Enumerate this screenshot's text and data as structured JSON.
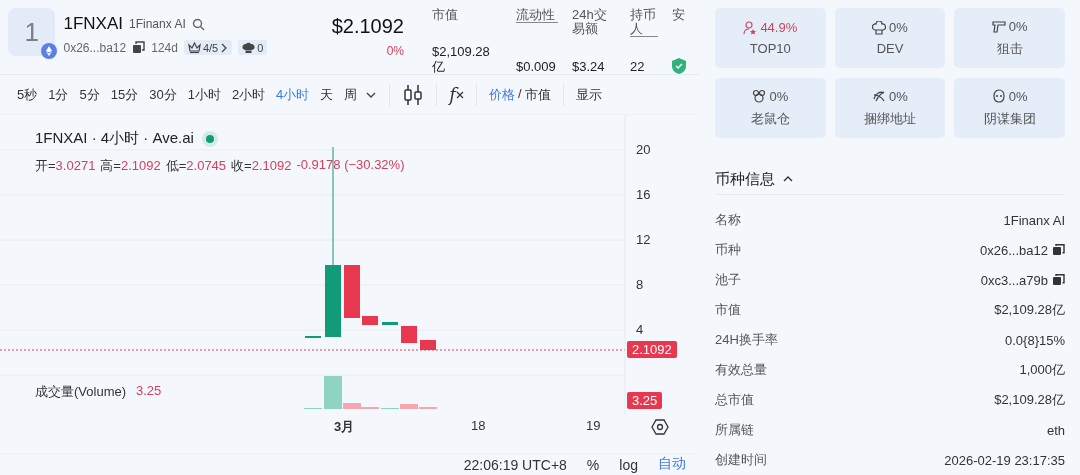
{
  "token": {
    "logo_char": "1",
    "symbol": "1FNXAI",
    "name": "1Finanx AI",
    "address": "0x26...ba12",
    "age": "124d",
    "rating": "4/5",
    "chef_count": "0",
    "price": "$2.1092",
    "change": "0%"
  },
  "stats": [
    {
      "label": "市值",
      "value": "$2,109.28亿",
      "underlined": false
    },
    {
      "label": "流动性",
      "value": "$0.009",
      "underlined": true
    },
    {
      "label": "24h交易额",
      "value": "$3.24",
      "underlined": false
    },
    {
      "label": "持币人",
      "value": "22",
      "underlined": true
    },
    {
      "label": "安",
      "shield": true
    }
  ],
  "toolbar": {
    "intervals": [
      {
        "label": "5秒",
        "selected": false
      },
      {
        "label": "1分",
        "selected": false
      },
      {
        "label": "5分",
        "selected": false
      },
      {
        "label": "15分",
        "selected": false
      },
      {
        "label": "30分",
        "selected": false
      },
      {
        "label": "1小时",
        "selected": false
      },
      {
        "label": "2小时",
        "selected": false
      },
      {
        "label": "4小时",
        "selected": true
      },
      {
        "label": "天",
        "selected": false
      },
      {
        "label": "周",
        "selected": false
      }
    ],
    "fx": "f",
    "price_toggle": [
      {
        "label": "价格",
        "selected": true
      },
      {
        "label": "市值",
        "selected": false
      }
    ],
    "toggle_separator": "/",
    "display": "显示"
  },
  "chart": {
    "title": "1FNXAI · 4小时 · Ave.ai",
    "ohlc": [
      {
        "key": "开=",
        "value": "3.0271"
      },
      {
        "key": "高=",
        "value": "2.1092"
      },
      {
        "key": "低=",
        "value": "2.0745"
      },
      {
        "key": "收=",
        "value": "2.1092"
      }
    ],
    "change": "-0.9178 (−30.32%)",
    "y_axis_labels": [
      "20",
      "16",
      "12",
      "8",
      "4"
    ],
    "price_tag": "2.1092",
    "volume_label": "成交量(Volume)",
    "volume_value": "3.25",
    "volume_tag": "3.25",
    "x_axis_labels": [
      "3月",
      "18",
      "19"
    ]
  },
  "bottom_bar": {
    "time": "22:06:19 UTC+8",
    "percent": "%",
    "log": "log",
    "auto": "自动"
  },
  "holder_cards": [
    {
      "kind": "top10",
      "value": "44.9%",
      "label": "TOP10",
      "alert": true
    },
    {
      "kind": "dev",
      "value": "0%",
      "label": "DEV",
      "alert": false
    },
    {
      "kind": "sniper",
      "value": "0%",
      "label": "狙击",
      "alert": false
    },
    {
      "kind": "rat",
      "value": "0%",
      "label": "老鼠仓",
      "alert": false
    },
    {
      "kind": "bundle",
      "value": "0%",
      "label": "捆绑地址",
      "alert": false
    },
    {
      "kind": "plot",
      "value": "0%",
      "label": "阴谋集团",
      "alert": false
    }
  ],
  "token_info": {
    "title": "币种信息",
    "expanded": true,
    "rows": [
      {
        "label": "名称",
        "value": "1Finanx AI",
        "copy": false
      },
      {
        "label": "币种",
        "value": "0x26...ba12",
        "copy": true
      },
      {
        "label": "池子",
        "value": "0xc3...a79b",
        "copy": true
      },
      {
        "label": "市值",
        "value": "$2,109.28亿",
        "copy": false
      },
      {
        "label": "24H换手率",
        "value": "0.0{8}15%",
        "copy": false
      },
      {
        "label": "有效总量",
        "value": "1,000亿",
        "copy": false
      },
      {
        "label": "总市值",
        "value": "$2,109.28亿",
        "copy": false
      },
      {
        "label": "所属链",
        "value": "eth",
        "copy": false
      },
      {
        "label": "创建时间",
        "value": "2026-02-19 23:17:35",
        "copy": false
      }
    ]
  }
}
